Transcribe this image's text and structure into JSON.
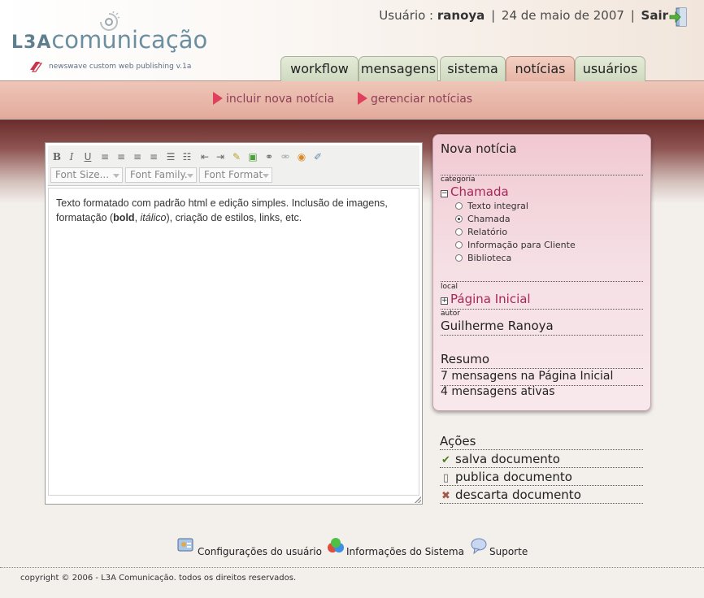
{
  "header": {
    "logo": {
      "brand": "L3A",
      "name": "comunicação"
    },
    "tagline": "newswave custom web publishing v.1a",
    "user_label": "Usuário :",
    "user_name": "ranoya",
    "date": "24 de maio de 2007",
    "logout": "Sair"
  },
  "tabs": [
    {
      "label": "workflow",
      "active": false
    },
    {
      "label": "mensagens",
      "active": false
    },
    {
      "label": "sistema",
      "active": false
    },
    {
      "label": "notícias",
      "active": true
    },
    {
      "label": "usuários",
      "active": false
    }
  ],
  "subnav": [
    {
      "label": "incluir nova notícia"
    },
    {
      "label": "gerenciar notícias"
    }
  ],
  "editor": {
    "selects": [
      {
        "label": "Font Size..."
      },
      {
        "label": "Font Family."
      },
      {
        "label": "Font Format"
      }
    ],
    "content": {
      "part1": "Texto formatado com padrão html e edição simples. Inclusão de imagens, formatação (",
      "bold": "bold",
      "sep": ", ",
      "italic": "itálico",
      "part2": "), criação de estilos, links, etc."
    }
  },
  "panel": {
    "title": "Nova notícia",
    "categoria_label": "categoria",
    "categoria_value": "Chamada",
    "options": [
      {
        "label": "Texto integral",
        "checked": false
      },
      {
        "label": "Chamada",
        "checked": true
      },
      {
        "label": "Relatório",
        "checked": false
      },
      {
        "label": "Informação para Cliente",
        "checked": false
      },
      {
        "label": "Biblioteca",
        "checked": false
      }
    ],
    "local_label": "local",
    "local_value": "Página Inicial",
    "autor_label": "autor",
    "autor_value": "Guilherme Ranoya",
    "resumo_title": "Resumo",
    "resumo_lines": [
      "7 mensagens na Página Inicial",
      "4 mensagens ativas"
    ]
  },
  "actions": {
    "title": "Ações",
    "items": [
      {
        "label": "salva documento",
        "icon": "check-icon"
      },
      {
        "label": "publica documento",
        "icon": "document-icon"
      },
      {
        "label": "descarta documento",
        "icon": "x-icon"
      }
    ]
  },
  "footer": {
    "links": [
      {
        "label": "Configurações do usuário"
      },
      {
        "label": "Informações do Sistema"
      },
      {
        "label": "Suporte"
      }
    ],
    "copyright": "copyright © 2006 - L3A Comunicação. todos os direitos reservados."
  },
  "colors": {
    "accent": "#a8275a",
    "tab_active": "#e7b4a5",
    "tab_inactive": "#cfd9bf",
    "band": "#6a2c2a"
  }
}
